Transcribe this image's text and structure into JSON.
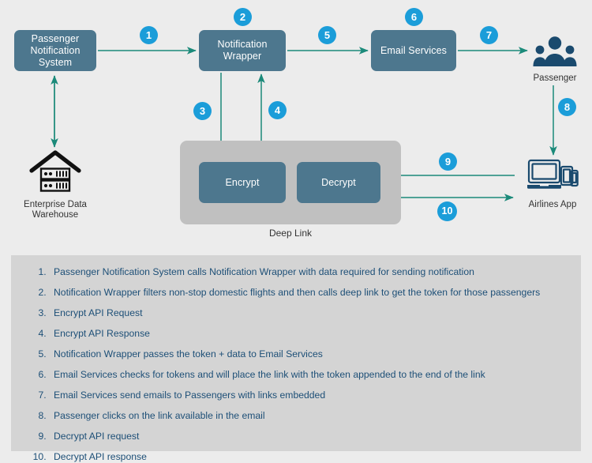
{
  "colors": {
    "background": "#ececec",
    "process_box": "#4d778e",
    "group_box": "#c0c0c0",
    "badge": "#1b9dd9",
    "arrow": "#1b8a7a",
    "legend_panel": "#d4d4d4",
    "legend_text": "#1d4f77",
    "icon_navy": "#1a4a6e",
    "icon_black": "#111111"
  },
  "diagram": {
    "boxes": {
      "passenger_notification_system": "Passenger\nNotification System",
      "passenger_notification_system_line1": "Passenger",
      "passenger_notification_system_line2": "Notification System",
      "notification_wrapper": "Notification Wrapper",
      "email_services": "Email Services",
      "encrypt": "Encrypt",
      "decrypt": "Decrypt"
    },
    "group": {
      "deep_link_label": "Deep Link"
    },
    "entities": [
      {
        "id": "passenger",
        "caption": "Passenger",
        "icon": "people-group-icon"
      },
      {
        "id": "airlines-app",
        "caption": "Airlines App",
        "icon": "devices-icon"
      },
      {
        "id": "enterprise-data-warehouse",
        "caption_line1": "Enterprise Data",
        "caption_line2": "Warehouse",
        "icon": "data-warehouse-icon"
      }
    ],
    "badges": [
      {
        "n": "1"
      },
      {
        "n": "2"
      },
      {
        "n": "3"
      },
      {
        "n": "4"
      },
      {
        "n": "5"
      },
      {
        "n": "6"
      },
      {
        "n": "7"
      },
      {
        "n": "8"
      },
      {
        "n": "9"
      },
      {
        "n": "10"
      }
    ]
  },
  "legend": {
    "steps": [
      "Passenger Notification System calls Notification Wrapper with data required for sending notification",
      "Notification Wrapper filters non-stop domestic flights and then calls deep link to get the token for those passengers",
      "Encrypt API Request",
      "Encrypt API Response",
      "Notification Wrapper passes the token + data to Email Services",
      "Email Services checks for tokens and will place the link with the token appended to the end of the link",
      "Email Services send emails to Passengers with links embedded",
      "Passenger clicks on the link available in the email",
      "Decrypt API request",
      "Decrypt API response"
    ]
  }
}
